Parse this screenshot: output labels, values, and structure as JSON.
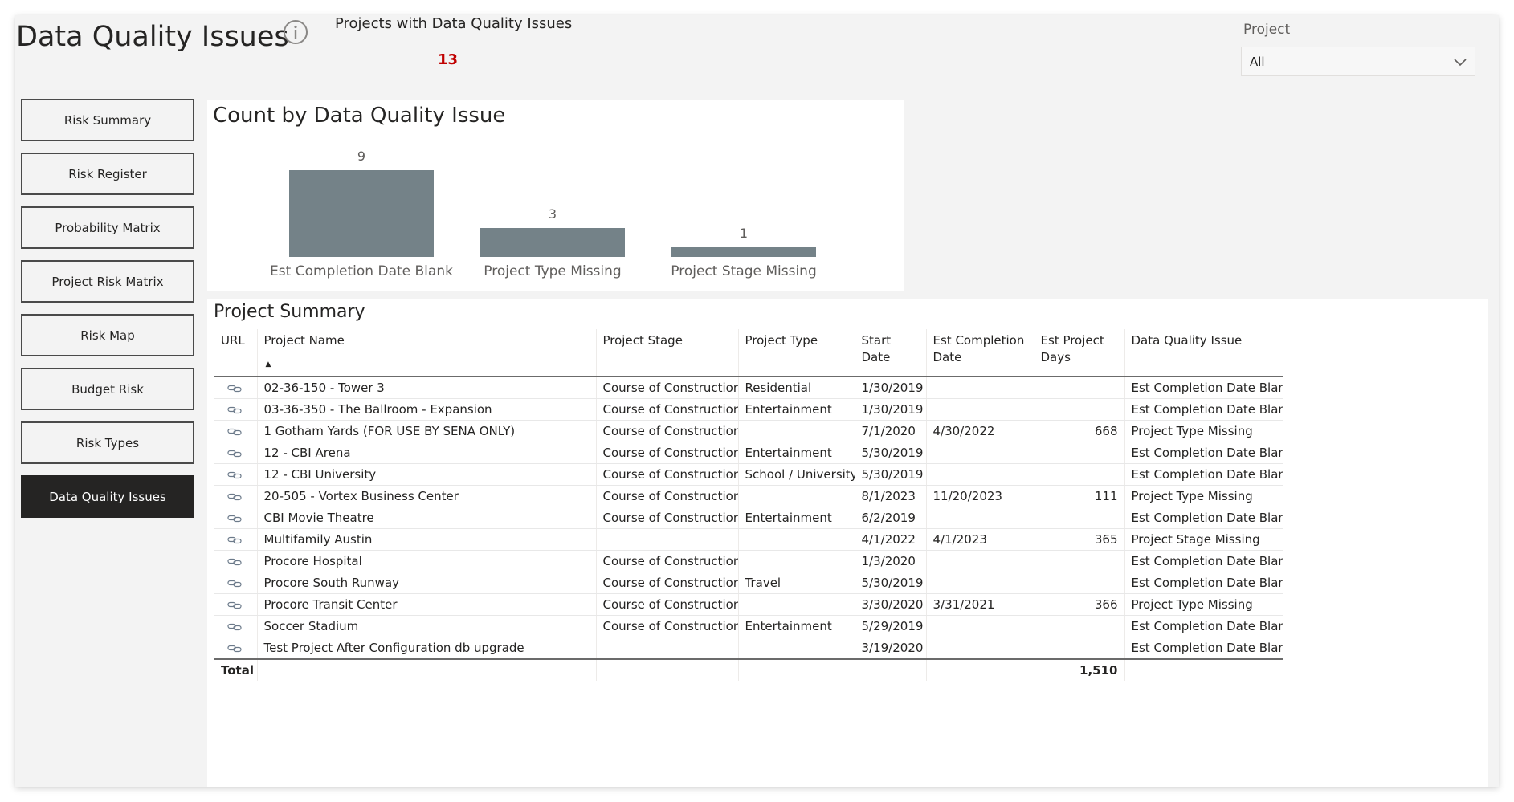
{
  "page": {
    "title": "Data Quality Issues"
  },
  "card": {
    "title": "Projects with Data Quality Issues",
    "value": "13",
    "value_color": "#c00000"
  },
  "slicer": {
    "label": "Project",
    "value": "All"
  },
  "nav": {
    "items": [
      {
        "label": "Risk Summary",
        "active": false
      },
      {
        "label": "Risk Register",
        "active": false
      },
      {
        "label": "Probability Matrix",
        "active": false
      },
      {
        "label": "Project Risk Matrix",
        "active": false
      },
      {
        "label": "Risk Map",
        "active": false
      },
      {
        "label": "Budget Risk",
        "active": false
      },
      {
        "label": "Risk Types",
        "active": false
      },
      {
        "label": "Data Quality Issues",
        "active": true
      }
    ]
  },
  "chart_data": {
    "type": "bar",
    "title": "Count by Data Quality Issue",
    "categories": [
      "Est Completion Date Blank",
      "Project Type Missing",
      "Project Stage Missing"
    ],
    "values": [
      9,
      3,
      1
    ],
    "ylim": [
      0,
      9
    ],
    "bar_color": "#748288",
    "xlabel": "",
    "ylabel": "",
    "grid": false
  },
  "table": {
    "title": "Project Summary",
    "columns": [
      "URL",
      "Project Name",
      "Project Stage",
      "Project Type",
      "Start Date",
      "Est Completion Date",
      "Est Project Days",
      "Data Quality Issue"
    ],
    "rows": [
      [
        "02-36-150 - Tower 3",
        "Course of Construction",
        "Residential",
        "1/30/2019",
        "",
        "",
        "Est Completion Date Blank"
      ],
      [
        "03-36-350 - The Ballroom - Expansion",
        "Course of Construction",
        "Entertainment",
        "1/30/2019",
        "",
        "",
        "Est Completion Date Blank"
      ],
      [
        "1 Gotham Yards (FOR USE BY SENA ONLY)",
        "Course of Construction",
        "",
        "7/1/2020",
        "4/30/2022",
        "668",
        "Project Type Missing"
      ],
      [
        "12 - CBI Arena",
        "Course of Construction",
        "Entertainment",
        "5/30/2019",
        "",
        "",
        "Est Completion Date Blank"
      ],
      [
        "12 - CBI University",
        "Course of Construction",
        "School / University",
        "5/30/2019",
        "",
        "",
        "Est Completion Date Blank"
      ],
      [
        "20-505 - Vortex Business Center",
        "Course of Construction",
        "",
        "8/1/2023",
        "11/20/2023",
        "111",
        "Project Type Missing"
      ],
      [
        "CBI Movie Theatre",
        "Course of Construction",
        "Entertainment",
        "6/2/2019",
        "",
        "",
        "Est Completion Date Blank"
      ],
      [
        "Multifamily Austin",
        "",
        "",
        "4/1/2022",
        "4/1/2023",
        "365",
        "Project Stage Missing"
      ],
      [
        "Procore Hospital",
        "Course of Construction",
        "",
        "1/3/2020",
        "",
        "",
        "Est Completion Date Blank"
      ],
      [
        "Procore South Runway",
        "Course of Construction",
        "Travel",
        "5/30/2019",
        "",
        "",
        "Est Completion Date Blank"
      ],
      [
        "Procore Transit Center",
        "Course of Construction",
        "",
        "3/30/2020",
        "3/31/2021",
        "366",
        "Project Type Missing"
      ],
      [
        "Soccer Stadium",
        "Course of Construction",
        "Entertainment",
        "5/29/2019",
        "",
        "",
        "Est Completion Date Blank"
      ],
      [
        "Test Project After Configuration db upgrade",
        "",
        "",
        "3/19/2020",
        "",
        "",
        "Est Completion Date Blank"
      ]
    ],
    "total_label": "Total",
    "total_days": "1,510"
  },
  "icons": {
    "info": "info-icon",
    "link": "link-icon",
    "chevron": "chevron-down-icon",
    "sort": "sort-ascending-icon"
  }
}
